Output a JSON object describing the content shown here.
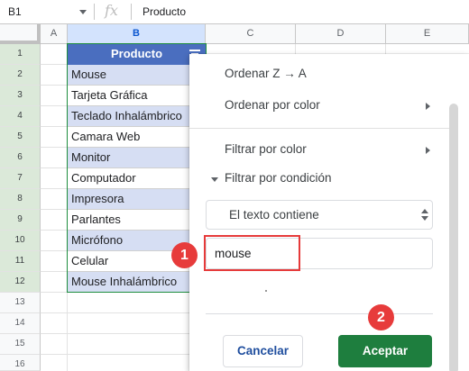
{
  "formula_bar": {
    "cell_reference": "B1",
    "fx_icon": "function-icon",
    "content": "Producto"
  },
  "columns": [
    "A",
    "B",
    "C",
    "D",
    "E"
  ],
  "rows": [
    "1",
    "2",
    "3",
    "4",
    "5",
    "6",
    "7",
    "8",
    "9",
    "10",
    "11",
    "12",
    "13",
    "14",
    "15",
    "16"
  ],
  "table": {
    "header": "Producto",
    "filter_icon": "filter-icon",
    "items": [
      "Mouse",
      "Tarjeta Gráfica",
      "Teclado Inhalámbrico",
      "Camara Web",
      "Monitor",
      "Computador",
      "Impresora",
      "Parlantes",
      "Micrófono",
      "Celular",
      "Mouse Inhalámbrico"
    ]
  },
  "filter_panel": {
    "sort_za": "Ordenar Z → A",
    "sort_by_color": "Ordenar por color",
    "filter_by_color": "Filtrar por color",
    "filter_by_condition": "Filtrar por condición",
    "condition_select": "El texto contiene",
    "condition_value": "mouse",
    "cancel_label": "Cancelar",
    "accept_label": "Aceptar"
  },
  "annotations": {
    "step1": "1",
    "step2": "2"
  },
  "colors": {
    "header_fill": "#4a6ebf",
    "band_fill": "#d6def3",
    "accept_button": "#1e7e3e",
    "annotation": "#e73b3b"
  }
}
